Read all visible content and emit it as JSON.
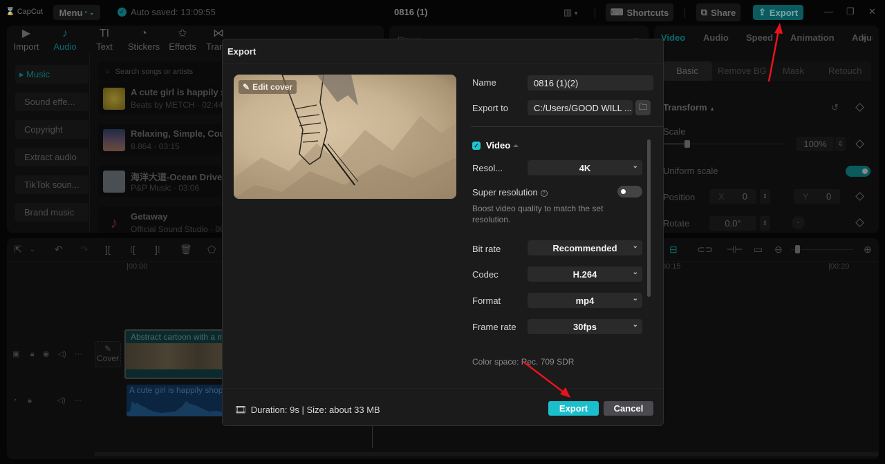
{
  "app": {
    "logo": "CapCut",
    "menu_label": "Menu",
    "autosave": "Auto saved: 13:09:55",
    "project_title": "0816 (1)",
    "shortcuts_label": "Shortcuts",
    "share_label": "Share",
    "export_label": "Export"
  },
  "toolbar_tabs": [
    {
      "label": "Import",
      "icon": "import-icon",
      "glyph": "▶"
    },
    {
      "label": "Audio",
      "icon": "audio-icon",
      "glyph": "♪",
      "active": true
    },
    {
      "label": "Text",
      "icon": "text-icon",
      "glyph": "TI"
    },
    {
      "label": "Stickers",
      "icon": "sticker-icon",
      "glyph": "◔"
    },
    {
      "label": "Effects",
      "icon": "effects-icon",
      "glyph": "✩"
    },
    {
      "label": "Transitions",
      "icon": "transition-icon",
      "glyph": "⋈"
    }
  ],
  "audio_categories": [
    "Music",
    "Sound effe...",
    "Copyright",
    "Extract audio",
    "TikTok soun...",
    "Brand music"
  ],
  "search": {
    "placeholder": "Search songs or artists"
  },
  "songs": [
    {
      "title": "A cute girl is happily s",
      "meta": "Beats by METCH · 02:44"
    },
    {
      "title": "Relaxing, Simple, Cou",
      "meta": "8.864 · 03:15"
    },
    {
      "title": "海洋大道-Ocean Drive",
      "meta": "P&P Music · 03:06"
    },
    {
      "title": "Getaway",
      "meta": "Official Sound Studio · 00"
    }
  ],
  "player": {
    "label": "Player"
  },
  "properties": {
    "tabs": [
      "Video",
      "Audio",
      "Speed",
      "Animation",
      "Adjust"
    ],
    "subtabs": [
      "Basic",
      "Remove BG",
      "Mask",
      "Retouch"
    ],
    "section": "Transform",
    "scale_label": "Scale",
    "scale_value": "100%",
    "uniform_scale_label": "Uniform scale",
    "uniform_scale_on": true,
    "position_label": "Position",
    "pos_x_label": "X",
    "pos_x": "0",
    "pos_y_label": "Y",
    "pos_y": "0",
    "rotate_label": "Rotate",
    "rotate_value": "0.0°"
  },
  "timeline": {
    "ruler": [
      "00:00",
      "00:15",
      "00:20"
    ],
    "cover_label": "Cover",
    "video_clip": "Abstract cartoon with a m",
    "audio_clip": "A cute girl is happily shop"
  },
  "dialog": {
    "title": "Export",
    "edit_cover": "Edit cover",
    "name_label": "Name",
    "name_value": "0816 (1)(2)",
    "export_to_label": "Export to",
    "export_to_value": "C:/Users/GOOD WILL ...",
    "video_section": "Video",
    "video_checked": true,
    "resolution_label": "Resol...",
    "resolution_value": "4K",
    "super_res_label": "Super resolution",
    "super_res_on": false,
    "super_res_desc": "Boost video quality to match the set resolution.",
    "bitrate_label": "Bit rate",
    "bitrate_value": "Recommended",
    "codec_label": "Codec",
    "codec_value": "H.264",
    "format_label": "Format",
    "format_value": "mp4",
    "framerate_label": "Frame rate",
    "framerate_value": "30fps",
    "color_space": "Color space: Rec. 709 SDR",
    "footer_info": "Duration: 9s | Size: about 33 MB",
    "export_button": "Export",
    "cancel_button": "Cancel"
  },
  "colors": {
    "accent": "#1bbfcc",
    "annotation_arrow": "#e8141b"
  }
}
